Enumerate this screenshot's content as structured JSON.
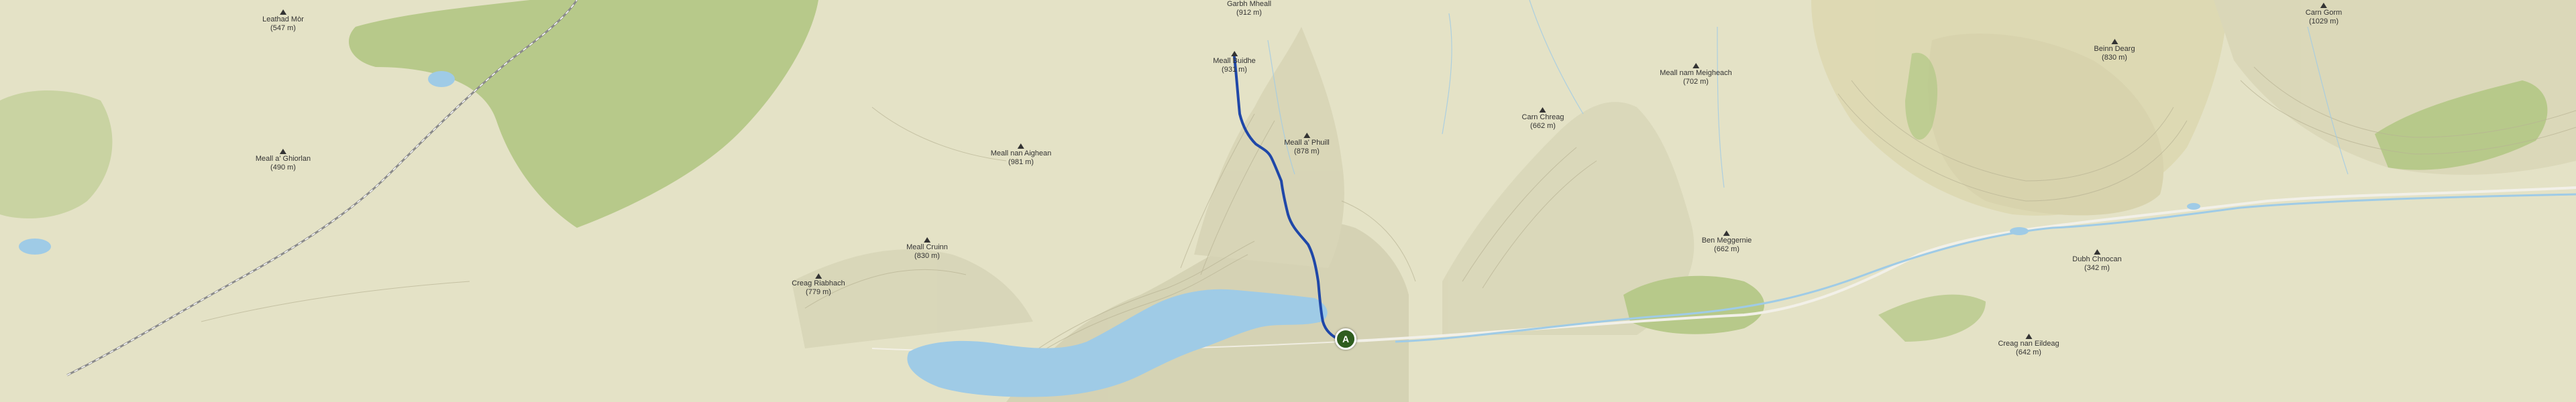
{
  "map": {
    "colors": {
      "land": "#e4e2c6",
      "forest": "#b7c98a",
      "water": "#9fcbe6",
      "route": "#1f47a8",
      "rail": "#8a8a8a",
      "road": "#f2f0e8",
      "marker": "#2f5d1f"
    },
    "route_marker": {
      "label": "A"
    },
    "peaks": [
      {
        "name": "Leathad Mòr",
        "elevation": "(547 m)"
      },
      {
        "name": "Meall a' Ghiorlan",
        "elevation": "(490 m)"
      },
      {
        "name": "Creag Riabhach",
        "elevation": "(779 m)"
      },
      {
        "name": "Meall Cruinn",
        "elevation": "(830 m)"
      },
      {
        "name": "Meall nan Aighean",
        "elevation": "(981 m)"
      },
      {
        "name": "Garbh Mheall",
        "elevation": "(912 m)"
      },
      {
        "name": "Meall Buidhe",
        "elevation": "(931 m)"
      },
      {
        "name": "Meall a' Phuill",
        "elevation": "(878 m)"
      },
      {
        "name": "Carn Chreag",
        "elevation": "(662 m)"
      },
      {
        "name": "Meall nam Meigheach",
        "elevation": "(702 m)"
      },
      {
        "name": "Ben Meggernie",
        "elevation": "(662 m)"
      },
      {
        "name": "Beinn Dearg",
        "elevation": "(830 m)"
      },
      {
        "name": "Carn Gorm",
        "elevation": "(1029 m)"
      },
      {
        "name": "Dubh Chnocan",
        "elevation": "(342 m)"
      },
      {
        "name": "Creag nan Eildeag",
        "elevation": "(642 m)"
      }
    ]
  }
}
